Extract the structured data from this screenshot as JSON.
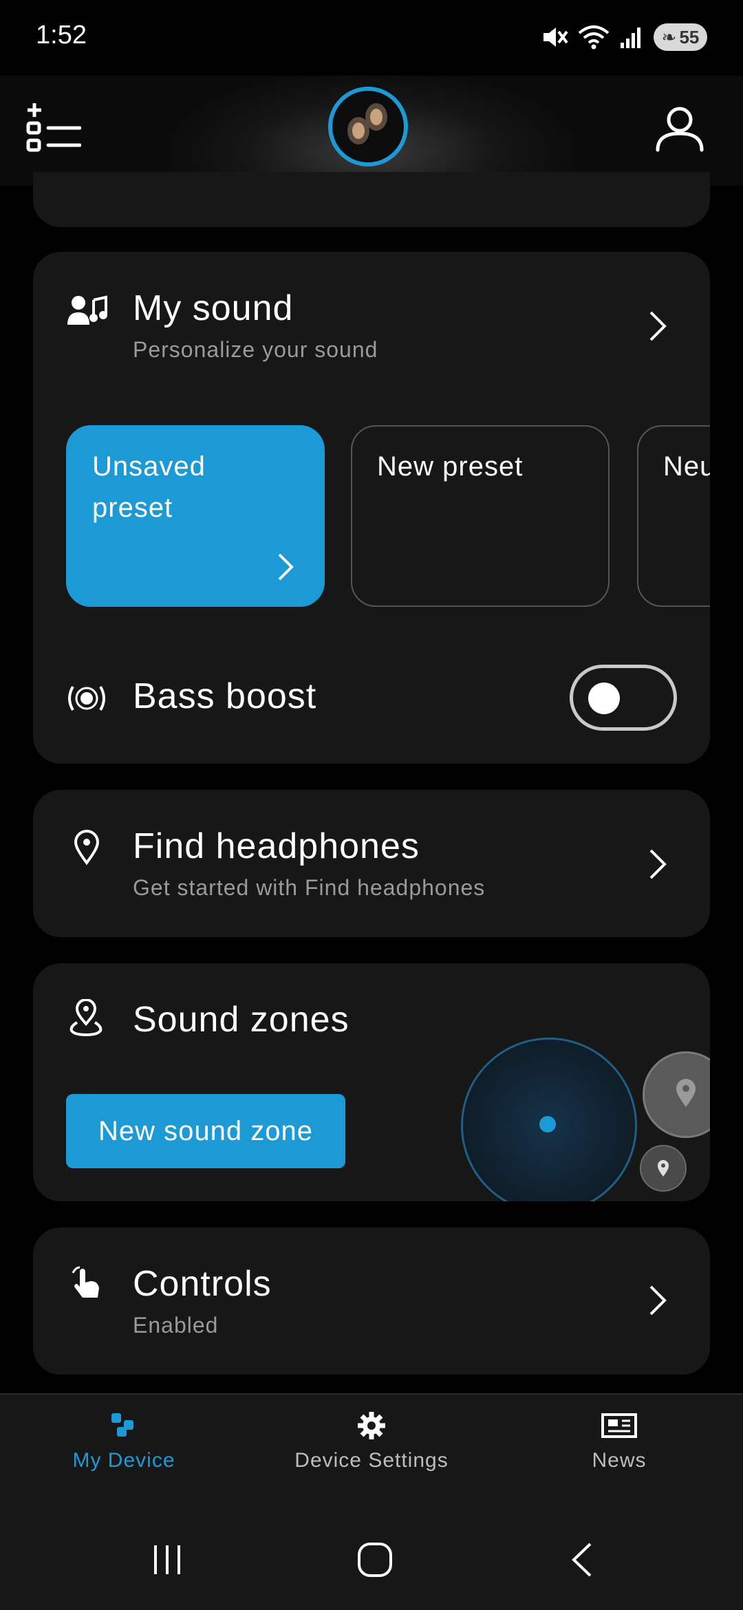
{
  "status_bar": {
    "time": "1:52",
    "battery": "55"
  },
  "header": {
    "menu_icon": "list-add-icon",
    "device_icon": "earbuds-image",
    "profile_icon": "person-icon"
  },
  "my_sound": {
    "title": "My sound",
    "subtitle": "Personalize your sound",
    "presets": [
      {
        "label": "Unsaved preset",
        "active": true
      },
      {
        "label": "New preset",
        "active": false
      },
      {
        "label": "Neu",
        "active": false
      }
    ],
    "bass_boost_label": "Bass boost",
    "bass_boost_on": false
  },
  "find_headphones": {
    "title": "Find headphones",
    "subtitle": "Get started with Find headphones"
  },
  "sound_zones": {
    "title": "Sound zones",
    "button_label": "New sound zone"
  },
  "controls": {
    "title": "Controls",
    "subtitle": "Enabled"
  },
  "bottom_nav": {
    "items": [
      {
        "label": "My Device",
        "active": true
      },
      {
        "label": "Device Settings",
        "active": false
      },
      {
        "label": "News",
        "active": false
      }
    ]
  },
  "colors": {
    "accent": "#1c9ad6",
    "card": "#171717",
    "background": "#000000"
  }
}
